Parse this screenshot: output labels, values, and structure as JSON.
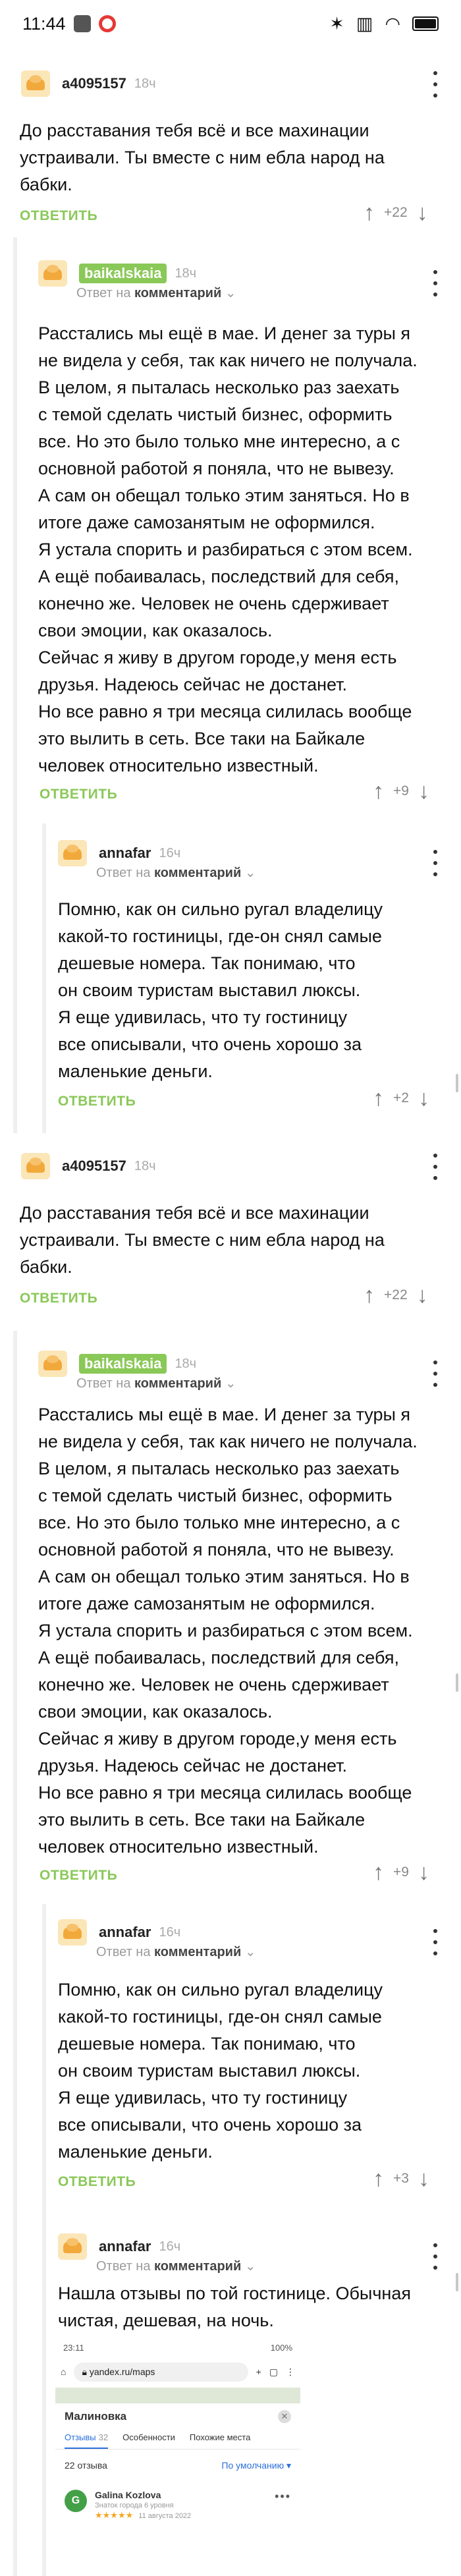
{
  "status_bar": {
    "time": "11:44",
    "battery": ""
  },
  "comments": [
    {
      "user": "a4095157",
      "time": "18ч",
      "reply_to": null,
      "text": "До расставания тебя всё и все махинации\nустраивали. Ты вместе с ним ебла народ на\nбабки.",
      "reply_label": "ОТВЕТИТЬ",
      "votes": "+22"
    },
    {
      "user": "baikalskaia",
      "time": "18ч",
      "reply_prefix": "Ответ на",
      "reply_to": "комментарий",
      "text": "Расстались мы ещё в мае. И денег за туры я\nне видела у себя, так как ничего не получала.\nВ целом, я пыталась несколько раз заехать\nс темой сделать чистый бизнес, оформить\nвсе. Но это было только мне интересно, а с\nосновной работой я поняла, что не вывезу.\nА сам он обещал только этим заняться. Но в\nитоге даже самозанятым не оформился.\nЯ устала спорить и разбираться с этом всем.\nА ещё побаивалась, последствий для себя,\nконечно же. Человек не очень сдерживает\nсвои эмоции, как оказалось.\nСейчас я живу в другом городе,у меня есть\nдрузья. Надеюсь сейчас не достанет.\nНо все равно я три месяца силилась вообще\nэто вылить в сеть. Все таки на Байкале\nчеловек относительно известный.",
      "reply_label": "ОТВЕТИТЬ",
      "votes": "+9"
    },
    {
      "user": "annafar",
      "time": "16ч",
      "reply_prefix": "Ответ на",
      "reply_to": "комментарий",
      "text": "Помню, как он сильно ругал владелицу\nкакой-то гостиницы, где-он снял самые\nдешевые номера. Так понимаю, что\nон своим туристам выставил люксы.\nЯ еще удивилась, что ту гостиницу\nвсе описывали, что очень хорошо за\nмаленькие деньги.",
      "reply_label": "ОТВЕТИТЬ",
      "votes": "+2"
    },
    {
      "user": "a4095157",
      "time": "18ч",
      "reply_to": null,
      "text": "До расставания тебя всё и все махинации\nустраивали. Ты вместе с ним ебла народ на\nбабки.",
      "reply_label": "ОТВЕТИТЬ",
      "votes": "+22"
    },
    {
      "user": "baikalskaia",
      "time": "18ч",
      "reply_prefix": "Ответ на",
      "reply_to": "комментарий",
      "text": "Расстались мы ещё в мае. И денег за туры я\nне видела у себя, так как ничего не получала.\nВ целом, я пыталась несколько раз заехать\nс темой сделать чистый бизнес, оформить\nвсе. Но это было только мне интересно, а с\nосновной работой я поняла, что не вывезу.\nА сам он обещал только этим заняться. Но в\nитоге даже самозанятым не оформился.\nЯ устала спорить и разбираться с этом всем.\nА ещё побаивалась, последствий для себя,\nконечно же. Человек не очень сдерживает\nсвои эмоции, как оказалось.\nСейчас я живу в другом городе,у меня есть\nдрузья. Надеюсь сейчас не достанет.\nНо все равно я три месяца силилась вообще\nэто вылить в сеть. Все таки на Байкале\nчеловек относительно известный.",
      "reply_label": "ОТВЕТИТЬ",
      "votes": "+9"
    },
    {
      "user": "annafar",
      "time": "16ч",
      "reply_prefix": "Ответ на",
      "reply_to": "комментарий",
      "text": "Помню, как он сильно ругал владелицу\nкакой-то гостиницы, где-он снял самые\nдешевые номера. Так понимаю, что\nон своим туристам выставил люксы.\nЯ еще удивилась, что ту гостиницу\nвсе описывали, что очень хорошо за\nмаленькие деньги.",
      "reply_label": "ОТВЕТИТЬ",
      "votes": "+3"
    },
    {
      "user": "annafar",
      "time": "16ч",
      "reply_prefix": "Ответ на",
      "reply_to": "комментарий",
      "text": "Нашла отзывы по той гостинице. Обычная\nчистая, дешевая, на ночь."
    }
  ],
  "embed": {
    "time": "23:11",
    "battery": "100%",
    "url": "yandex.ru/maps",
    "place": "Малиновка",
    "tabs": [
      {
        "label": "Отзывы",
        "count": "32"
      },
      {
        "label": "Особенности",
        "count": ""
      },
      {
        "label": "Похожие места",
        "count": ""
      }
    ],
    "reviews_count": "22 отзыва",
    "sort_label": "По умолчанию",
    "review": {
      "initial": "G",
      "name": "Galina Kozlova",
      "subtitle": "Знаток города 6 уровня",
      "stars": "★★★★★",
      "date": "11 августа 2022"
    }
  }
}
